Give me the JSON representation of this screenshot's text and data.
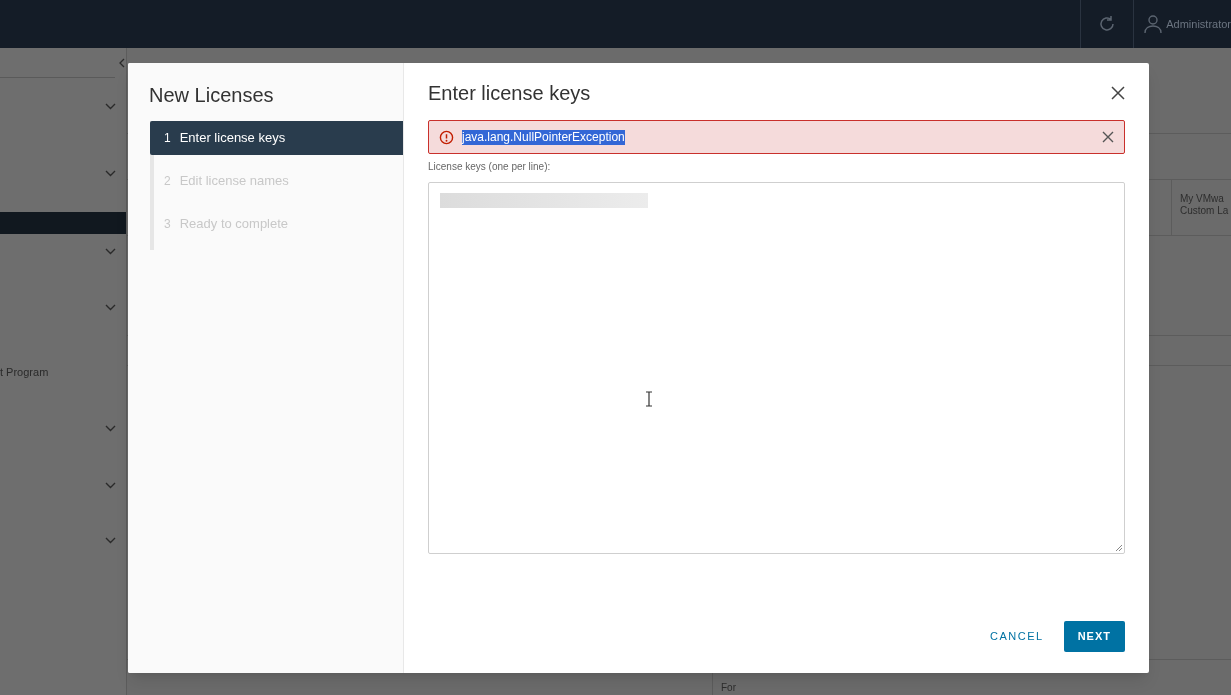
{
  "top_bar": {
    "user": "Administrator"
  },
  "sidebar": {
    "items": [
      {
        "kind": "group",
        "selected": false
      },
      {
        "kind": "group",
        "selected": false
      },
      {
        "kind": "row",
        "selected": true
      },
      {
        "kind": "group",
        "selected": false
      },
      {
        "kind": "group",
        "selected": false
      },
      {
        "kind": "link",
        "label": "t Program",
        "selected": false
      },
      {
        "kind": "group",
        "selected": false
      },
      {
        "kind": "group",
        "selected": false
      },
      {
        "kind": "group",
        "selected": false
      }
    ]
  },
  "table": {
    "column_header": [
      "My VMwa",
      "Custom La"
    ],
    "cell": "For"
  },
  "dialog": {
    "title": "New Licenses",
    "steps": [
      {
        "number": "1",
        "label": "Enter license keys",
        "selected": true
      },
      {
        "number": "2",
        "label": "Edit license names",
        "selected": false
      },
      {
        "number": "3",
        "label": "Ready to complete",
        "selected": false
      }
    ],
    "heading": "Enter license keys",
    "error": {
      "message": "java.lang.NullPointerException",
      "highlighted": true
    },
    "field_label": "License keys (one per line):",
    "buttons": [
      {
        "label": "CANCEL",
        "kind": "flat"
      },
      {
        "label": "NEXT",
        "kind": "primary"
      }
    ]
  }
}
